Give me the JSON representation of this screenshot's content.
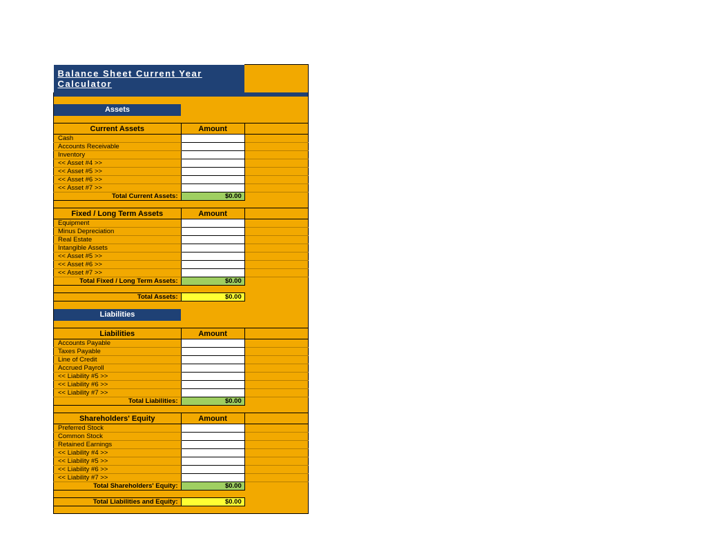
{
  "title": "Balance Sheet Current Year Calculator",
  "sectionAssets": "Assets",
  "sectionLiab": "Liabilities",
  "amountHeader": "Amount",
  "currentAssets": {
    "header": "Current Assets",
    "items": [
      "Cash",
      "Accounts Receivable",
      "Inventory",
      "<< Asset #4 >>",
      "<< Asset #5 >>",
      "<< Asset #6 >>",
      "<< Asset #7 >>"
    ],
    "totalLabel": "Total Current Assets:",
    "totalValue": "$0.00"
  },
  "fixedAssets": {
    "header": "Fixed / Long Term Assets",
    "items": [
      "Equipment",
      "Minus Depreciation",
      "Real Estate",
      "Intangible Assets",
      "<< Asset #5 >>",
      "<< Asset #6 >>",
      "<< Asset #7 >>"
    ],
    "totalLabel": "Total Fixed / Long Term Assets:",
    "totalValue": "$0.00"
  },
  "totalAssetsLabel": "Total Assets:",
  "totalAssetsValue": "$0.00",
  "liabilities": {
    "header": "Liabilities",
    "items": [
      "Accounts Payable",
      "Taxes Payable",
      "Line of Credit",
      "Accrued Payroll",
      "<< Liability #5 >>",
      "<< Liability #6 >>",
      "<< Liability #7 >>"
    ],
    "totalLabel": "Total Liabilities:",
    "totalValue": "$0.00"
  },
  "equity": {
    "header": "Shareholders' Equity",
    "items": [
      "Preferred Stock",
      "Common Stock",
      "Retained Earnings",
      "<< Liability #4 >>",
      "<< Liability #5 >>",
      "<< Liability #6 >>",
      "<< Liability #7 >>"
    ],
    "totalLabel": "Total Shareholders' Equity:",
    "totalValue": "$0.00"
  },
  "totalLiabLabel": "Total Liabilities and Equity:",
  "totalLiabValue": "$0.00"
}
